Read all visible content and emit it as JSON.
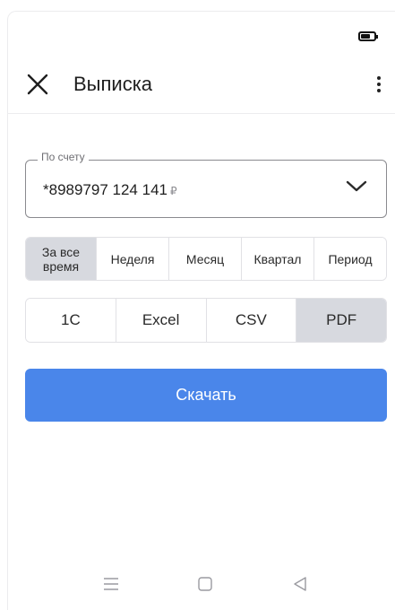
{
  "header": {
    "title": "Выписка",
    "close_icon": "close-icon",
    "menu_icon": "more-vert-icon"
  },
  "account": {
    "legend": "По счету",
    "value": "*8989797  124 141",
    "currency": "₽",
    "dropdown_icon": "chevron-down-icon"
  },
  "period": {
    "options": [
      "За все время",
      "Неделя",
      "Месяц",
      "Квартал",
      "Период"
    ],
    "selected": "За все время"
  },
  "format": {
    "options": [
      "1C",
      "Excel",
      "CSV",
      "PDF"
    ],
    "selected": "PDF"
  },
  "download": {
    "label": "Скачать"
  },
  "nav": {
    "icons": [
      "menu-icon",
      "home-icon",
      "back-icon"
    ]
  },
  "colors": {
    "accent": "#4a86ea",
    "selected_segment": "#d7d9df",
    "border": "#e1e1e5"
  }
}
